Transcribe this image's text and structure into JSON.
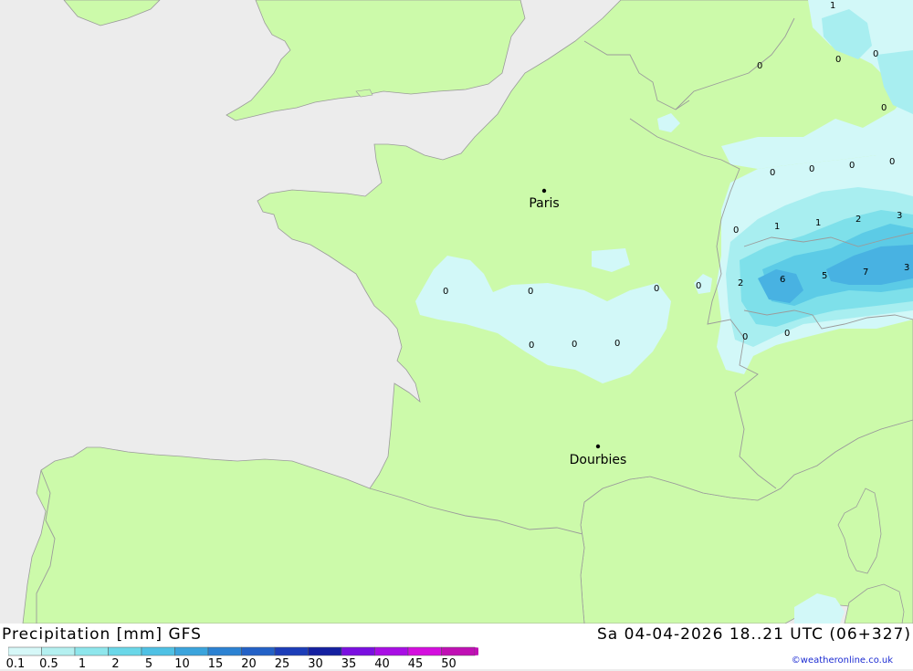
{
  "header": {
    "title": "Precipitation [mm] GFS",
    "valid_time": "Sa 04-04-2026 18..21 UTC (06+327)",
    "credit": "©weatheronline.co.uk"
  },
  "colors": {
    "sea": "#ececec",
    "land": "#ccfaaa",
    "border": "#9b9b9b",
    "precip": [
      "#d2f8f8",
      "#a8eef0",
      "#7ee0ea",
      "#5ccbe6",
      "#48b2e2",
      "#3a96da"
    ]
  },
  "legend": {
    "ticks": [
      "0.1",
      "0.5",
      "1",
      "2",
      "5",
      "10",
      "15",
      "20",
      "25",
      "30",
      "35",
      "40",
      "45",
      "50"
    ],
    "colors": [
      "#d6f8f8",
      "#b4f0f0",
      "#8ee6ec",
      "#6ad7e8",
      "#4fc1e4",
      "#3ba4dc",
      "#2c82d2",
      "#2361c6",
      "#1c3db8",
      "#1420a0",
      "#7a0fe0",
      "#a80ee4",
      "#d40ede",
      "#c010b4"
    ]
  },
  "cities": [
    {
      "name": "Paris"
    },
    {
      "name": "Dourbies"
    }
  ],
  "values": [
    "1",
    "0",
    "0",
    "0",
    "0",
    "0",
    "0",
    "0",
    "0",
    "1",
    "1",
    "2",
    "3",
    "0",
    "0",
    "2",
    "6",
    "5",
    "7",
    "3",
    "0",
    "0",
    "0",
    "0",
    "0",
    "0",
    "0",
    "0"
  ]
}
